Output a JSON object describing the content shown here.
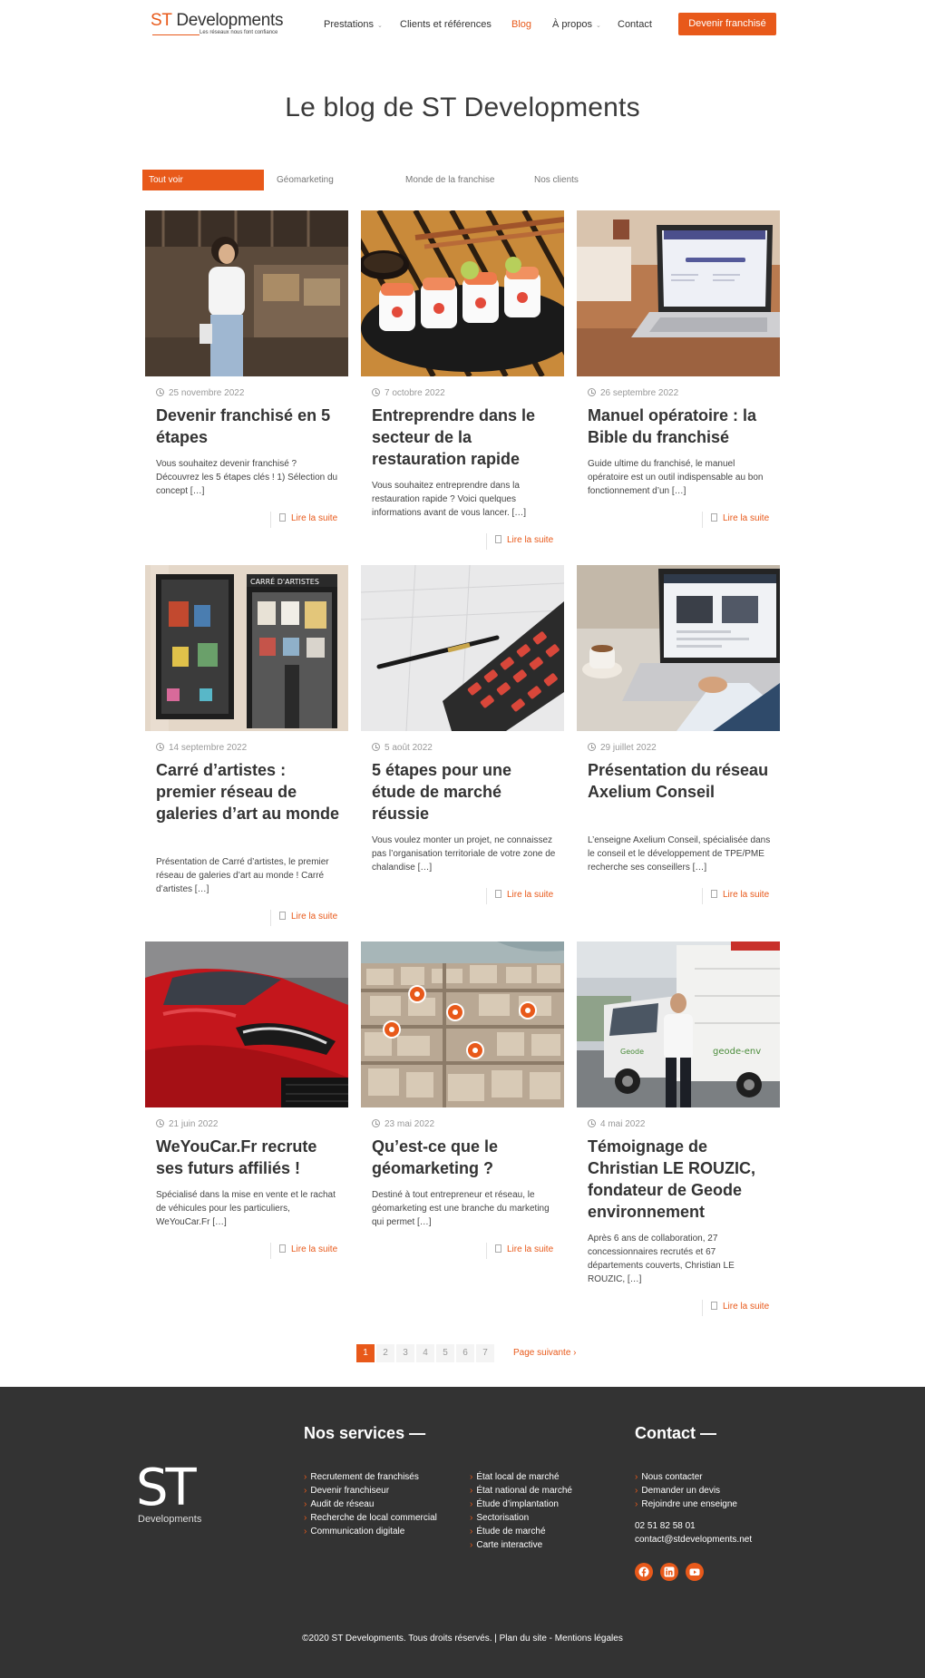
{
  "header": {
    "logo_st": "ST",
    "logo_name": "Developments",
    "logo_tagline": "Les réseaux nous font confiance",
    "nav": [
      {
        "label": "Prestations",
        "has_dropdown": true
      },
      {
        "label": "Clients et références",
        "has_dropdown": false
      },
      {
        "label": "Blog",
        "has_dropdown": false,
        "active": true
      },
      {
        "label": "À propos",
        "has_dropdown": true
      },
      {
        "label": "Contact",
        "has_dropdown": false
      }
    ],
    "cta_label": "Devenir franchisé"
  },
  "page_title": "Le blog de ST Developments",
  "filters": [
    "Tout voir",
    "Géomarketing",
    "Monde de la franchise",
    "Nos clients"
  ],
  "posts": [
    {
      "date": "25 novembre 2022",
      "title": "Devenir franchisé en 5 étapes",
      "excerpt": "Vous souhaitez devenir franchisé ? Découvrez les 5 étapes clés ! 1) Sélection du concept […]",
      "read_more": "Lire la suite",
      "image": "woman-in-restaurant-photo"
    },
    {
      "date": "7 octobre 2022",
      "title": "Entreprendre dans le secteur de la restauration rapide",
      "excerpt": "Vous souhaitez entreprendre dans la restauration rapide ? Voici quelques informations avant de vous lancer. […]",
      "read_more": "Lire la suite",
      "image": "sushi-plate-photo"
    },
    {
      "date": "26 septembre 2022",
      "title": "Manuel opératoire : la Bible du franchisé",
      "excerpt": "Guide ultime du franchisé, le manuel opératoire est un outil indispensable au bon fonctionnement d’un […]",
      "read_more": "Lire la suite",
      "image": "laptop-on-desk-photo"
    },
    {
      "date": "14 septembre 2022",
      "title": "Carré d’artistes : premier réseau de galeries d’art au monde",
      "excerpt": "Présentation de Carré d’artistes, le premier réseau de galeries d’art au monde ! Carré d’artistes […]",
      "read_more": "Lire la suite",
      "image": "art-gallery-storefront-photo"
    },
    {
      "date": "5 août 2022",
      "title": "5 étapes pour une étude de marché réussie",
      "excerpt": "Vous voulez monter un projet, ne connaissez pas l’organisation territoriale de votre zone de chalandise […]",
      "read_more": "Lire la suite",
      "image": "calculator-and-pen-photo"
    },
    {
      "date": "29 juillet 2022",
      "title": "Présentation du réseau Axelium Conseil",
      "excerpt": "L’enseigne Axelium Conseil, spécialisée dans le conseil et le développement de TPE/PME recherche ses conseillers […]",
      "read_more": "Lire la suite",
      "image": "person-using-laptop-photo"
    },
    {
      "date": "21 juin 2022",
      "title": "WeYouCar.Fr recrute ses futurs affiliés !",
      "excerpt": "Spécialisé dans la mise en vente et le rachat de véhicules pour les particuliers, WeYouCar.Fr […]",
      "read_more": "Lire la suite",
      "image": "red-car-photo"
    },
    {
      "date": "23 mai 2022",
      "title": "Qu’est-ce que le géomarketing ?",
      "excerpt": "Destiné à tout entrepreneur et réseau, le géomarketing est une branche du marketing qui permet […]",
      "read_more": "Lire la suite",
      "image": "aerial-city-with-map-pins-photo"
    },
    {
      "date": "4 mai 2022",
      "title": "Témoignage de Christian LE ROUZIC, fondateur de Geode environnement",
      "excerpt": "Après 6 ans de collaboration, 27 concessionnaires recrutés et 67 départements couverts, Christian LE ROUZIC, […]",
      "read_more": "Lire la suite",
      "image": "man-in-front-of-truck-photo"
    }
  ],
  "pagination": {
    "pages": [
      "1",
      "2",
      "3",
      "4",
      "5",
      "6",
      "7"
    ],
    "current": "1",
    "next_label": "Page suivante"
  },
  "footer": {
    "logo_st": "ST",
    "logo_name": "Developments",
    "services_title": "Nos services —",
    "services_col1": [
      "Recrutement de franchisés",
      "Devenir franchiseur",
      "Audit de réseau",
      "Recherche de local commercial",
      "Communication digitale"
    ],
    "services_col2": [
      "État local de marché",
      "État national de marché",
      "Étude d’implantation",
      "Sectorisation",
      "Étude de marché",
      "Carte interactive"
    ],
    "contact_title": "Contact —",
    "contact_links": [
      "Nous contacter",
      "Demander un devis",
      "Rejoindre une enseigne"
    ],
    "phone": "02 51 82 58 01",
    "email": "contact@stdevelopments.net",
    "social_icons": [
      "facebook-icon",
      "linkedin-icon",
      "youtube-icon"
    ],
    "copyright": "©2020 ST Developments. Tous droits réservés.",
    "separator": " | ",
    "sitemap": "Plan du site",
    "dash": " - ",
    "legal": "Mentions légales"
  },
  "colors": {
    "accent": "#e8591a",
    "footer_bg": "#333333",
    "text": "#333333"
  }
}
